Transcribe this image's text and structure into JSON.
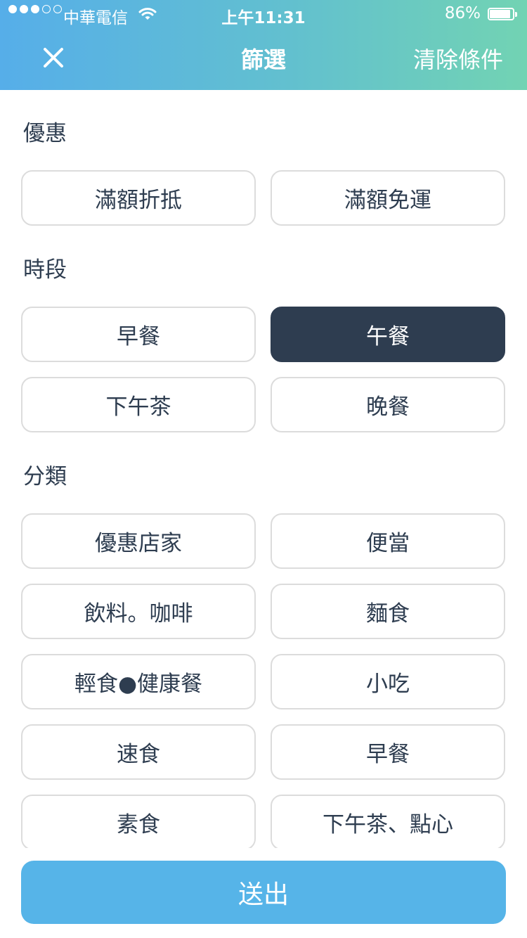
{
  "status_bar": {
    "carrier": "中華電信",
    "time": "上午11:31",
    "battery": "86%",
    "battery_level": 0.86,
    "signal_strength": 3
  },
  "header": {
    "title": "篩選",
    "clear_label": "清除條件",
    "close_icon": "close-icon"
  },
  "sections": {
    "discount": {
      "title": "優惠",
      "options": [
        "滿額折抵",
        "滿額免運"
      ]
    },
    "time_period": {
      "title": "時段",
      "options": [
        "早餐",
        "午餐",
        "下午茶",
        "晚餐"
      ],
      "selected": "午餐"
    },
    "category": {
      "title": "分類",
      "options": [
        "優惠店家",
        "便當",
        "飲料。咖啡",
        "麵食",
        "輕食●健康餐",
        "小吃",
        "速食",
        "早餐",
        "素食",
        "下午茶、點心"
      ]
    }
  },
  "submit_label": "送出",
  "colors": {
    "header_gradient_start": "#56aee9",
    "header_gradient_end": "#72d3b3",
    "selected_chip": "#2e3d50",
    "submit_button": "#56b4e8",
    "chip_border": "#dcdcdc"
  }
}
